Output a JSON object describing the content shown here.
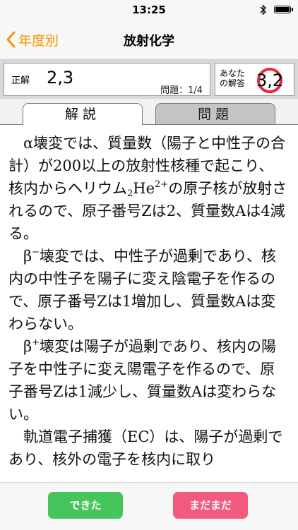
{
  "status": {
    "time": "13:25"
  },
  "nav": {
    "back_label": "年度別",
    "title": "放射化学"
  },
  "answer": {
    "correct_label": "正解",
    "correct_value": "2,3",
    "question_counter": "問題：1/4",
    "your_label": "あなた\nの解答",
    "your_value": "3,2"
  },
  "tabs": {
    "explanation": "解説",
    "question": "問題"
  },
  "explanation": {
    "p1_a": "α壊変では、質量数（陽子と中性子の合計）が200以上の放射性核種で起こり、核内からヘリウム",
    "p1_sub": "2",
    "p1_he": "He",
    "p1_sup": "2+",
    "p1_b": "の原子核が放射されるので、原子番号Zは2、質量数Aは4減る。",
    "p2_a": "β",
    "p2_sup": "−",
    "p2_b": "壊変では、中性子が過剰であり、核内の中性子を陽子に変え陰電子を作るので、原子番号Zは1増加し、質量数Aは変わらない。",
    "p3_a": "β",
    "p3_sup": "+",
    "p3_b": "壊変は陽子が過剰であり、核内の陽子を中性子に変え陽電子を作るので、原子番号Zは1減少し、質量数Aは変わらない。",
    "p4": "軌道電子捕獲（EC）は、陽子が過剰であり、核外の電子を核内に取り"
  },
  "footer": {
    "ok_label": "できた",
    "ng_label": "まだまだ"
  },
  "colors": {
    "accent": "#f39800",
    "ok": "#47c55d",
    "ng": "#f25a7e",
    "wrong_mark": "#e8283c"
  }
}
